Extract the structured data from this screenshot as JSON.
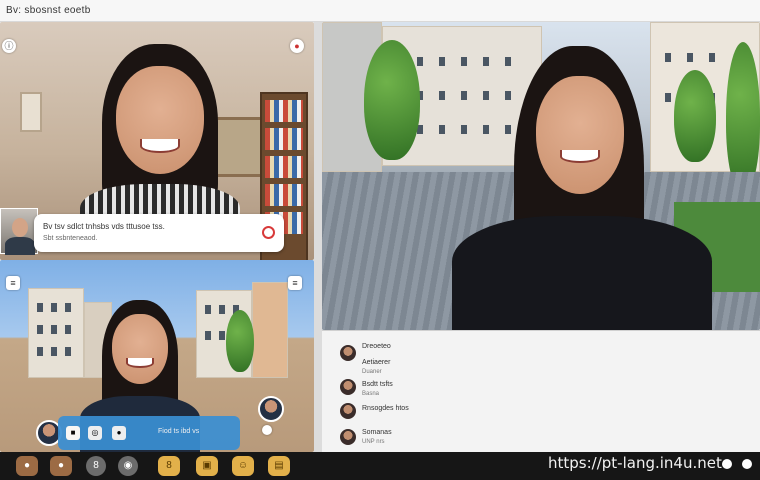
{
  "window": {
    "title": "Bv: sbosnst eoetb"
  },
  "tiles": {
    "top_left": {
      "corner_left_icon": "info-icon",
      "corner_right_icon": "pin-icon"
    },
    "bottom_left": {
      "corner_left_icon": "menu-icon",
      "corner_right_icon": "menu-icon"
    }
  },
  "chat_bubble": {
    "line1": "Bv tsv sdlct tnhsbs vds tttusoe tss.",
    "line2": "Sbt ssbnteneaod.",
    "send_icon": "send-icon"
  },
  "bubble_bar": {
    "text": "Fiod ts ibd vs"
  },
  "participants": [
    {
      "name": "Dreoeteo",
      "sub": ""
    },
    {
      "name": "Aetiaerer",
      "sub": "Duaner"
    },
    {
      "name": "Bsdtt tsfts",
      "sub": "Basna"
    },
    {
      "name": "Rnsogdes htos",
      "sub": ""
    },
    {
      "name": "Somanas",
      "sub": "UNP nrs"
    }
  ],
  "toolbar": {
    "buttons": [
      "camera-icon",
      "reaction-icon",
      "mic-icon",
      "record-icon",
      "share-icon",
      "chat-icon",
      "emoji-icon",
      "more-icon"
    ]
  },
  "watermark": "https://pt-lang.in4u.net"
}
